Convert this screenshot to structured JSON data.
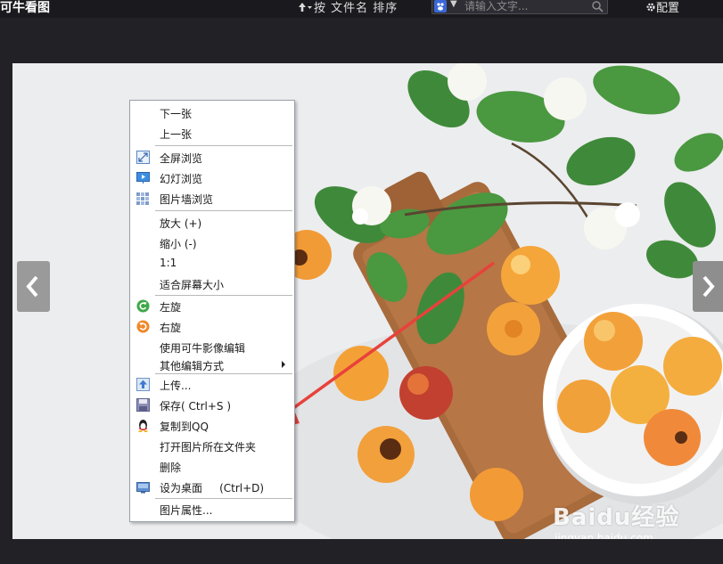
{
  "app": {
    "title": "可牛看图"
  },
  "toolbar": {
    "sort_label": "按 文件名 排序",
    "search_placeholder": "请输入文字...",
    "settings_label": "配置"
  },
  "menu": {
    "items": [
      {
        "label": "下一张",
        "icon": ""
      },
      {
        "label": "上一张",
        "icon": ""
      },
      {
        "label": "全屏浏览",
        "icon": "fullscreen-icon"
      },
      {
        "label": "幻灯浏览",
        "icon": "slideshow-icon"
      },
      {
        "label": "图片墙浏览",
        "icon": "image-wall-icon"
      },
      {
        "label": "放大 (+)",
        "icon": ""
      },
      {
        "label": "缩小 (-)",
        "icon": ""
      },
      {
        "label": "1:1",
        "icon": ""
      },
      {
        "label": "适合屏幕大小",
        "icon": ""
      },
      {
        "label": "左旋",
        "icon": "rotate-left-icon"
      },
      {
        "label": "右旋",
        "icon": "rotate-right-icon"
      },
      {
        "label": "使用可牛影像编辑",
        "icon": ""
      },
      {
        "label": "其他编辑方式",
        "icon": "",
        "submenu": true
      },
      {
        "label": "上传...",
        "icon": "upload-icon"
      },
      {
        "label": "保存( Ctrl+S )",
        "icon": "save-icon"
      },
      {
        "label": "复制到QQ",
        "icon": "qq-icon"
      },
      {
        "label": "打开图片所在文件夹",
        "icon": ""
      },
      {
        "label": "删除",
        "icon": ""
      },
      {
        "label": "设为桌面     (Ctrl+D)",
        "icon": "wallpaper-icon"
      },
      {
        "label": "图片属性...",
        "icon": ""
      }
    ]
  },
  "watermark": {
    "text": "Baidu经验",
    "url": "jingyan.baidu.com"
  },
  "colors": {
    "annotation_arrow": "#e8413b",
    "background": "#212126"
  }
}
